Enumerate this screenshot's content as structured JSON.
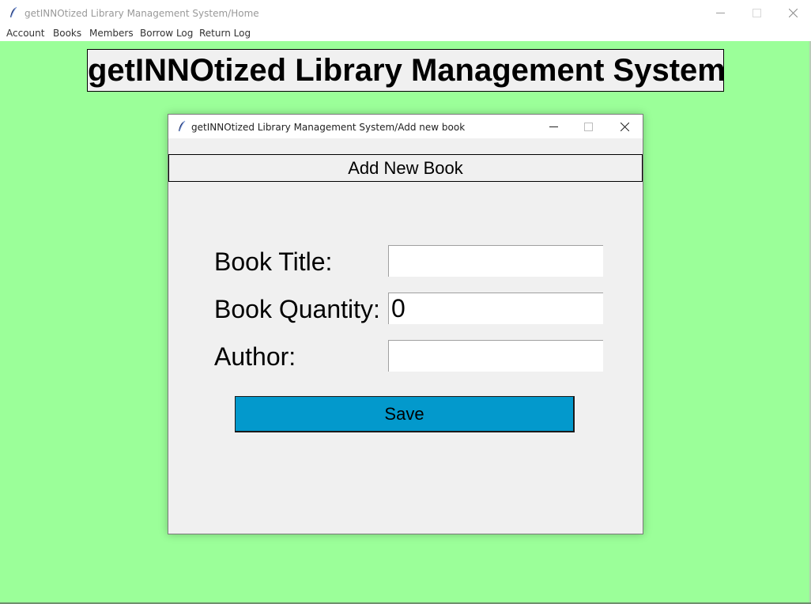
{
  "main_window": {
    "title": "getINNOtized Library Management System/Home",
    "menu": [
      "Account",
      "Books",
      "Members",
      "Borrow Log",
      "Return Log"
    ],
    "heading": "getINNOtized Library Management System",
    "background_color": "#9bff99"
  },
  "dialog": {
    "title": "getINNOtized Library Management System/Add new book",
    "heading": "Add New Book",
    "fields": [
      {
        "label": "Book Title:",
        "value": ""
      },
      {
        "label": "Book Quantity:",
        "value": "0"
      },
      {
        "label": "Author:",
        "value": ""
      }
    ],
    "save_label": "Save",
    "save_color": "#0399cc"
  },
  "icons": {
    "app": "feather-icon",
    "minimize": "minimize-icon",
    "maximize": "maximize-icon",
    "close": "close-icon"
  }
}
